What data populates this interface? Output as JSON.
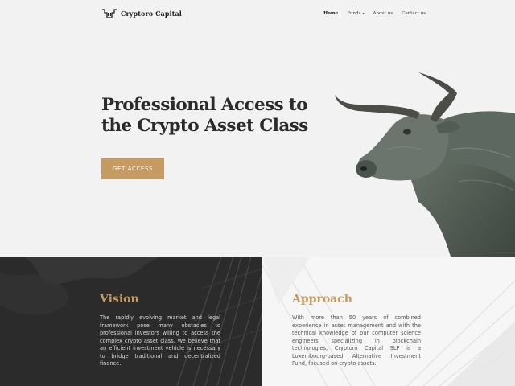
{
  "brand": {
    "name": "Cryptoro Capital",
    "logo_icon": "bull-horns-icon"
  },
  "nav": {
    "items": [
      {
        "label": "Home",
        "active": true
      },
      {
        "label": "Funds",
        "has_dropdown": true
      },
      {
        "label": "About us"
      },
      {
        "label": "Contact us"
      }
    ],
    "dropdown_icon": "chevron-down-icon"
  },
  "hero": {
    "headline_line1": "Professional Access to",
    "headline_line2": "the Crypto Asset Class",
    "cta_label": "GET ACCESS",
    "image": "bull-statue"
  },
  "vision": {
    "title": "Vision",
    "body": "The rapidly evolving market and legal framework pose many obstacles to professional investors willing to access the complex crypto asset class. We believe that an efficient investment vehicle is necessary to bridge traditional and decentralized finance."
  },
  "approach": {
    "title": "Approach",
    "body": "With more than 50 years of combined experience in asset management and with the technical knowledge of our computer science engineers specializing in blockchain technologies, Cryptoro Capital SLP is a Luxembourg-based Alternative Investment Fund, focused on crypto assets."
  },
  "colors": {
    "accent": "#c59a63",
    "dark": "#2b2b2b",
    "light_bg": "#f2f2f2",
    "text": "#2a2a2a"
  }
}
